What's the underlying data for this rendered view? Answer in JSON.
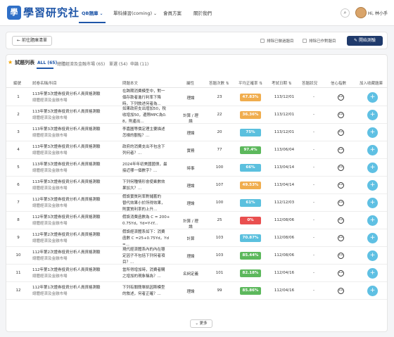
{
  "header": {
    "logo_text": "學",
    "brand": "學習研究社",
    "nav": [
      "QB題庫",
      "單科練習(coming)",
      "會員方案",
      "關於我們"
    ],
    "user": "Hi, 林小手"
  },
  "toolbar": {
    "back_label": "前往題庫清單",
    "exclude_done": "排除已做過題目",
    "exclude_marked": "排除已作對題目",
    "start_label": "開始測驗"
  },
  "list": {
    "title": "試題列表",
    "tabs": [
      "ALL (65)",
      "總體經濟及金融市場 (65)",
      "單選 (54)",
      "申論 (11)"
    ],
    "columns": [
      "編號",
      "試卷名稱/科目",
      "問題本文",
      "屬性",
      "答題次數",
      "平均正確率",
      "考試日期",
      "答題狀況",
      "信心指數",
      "加入收藏題庫"
    ],
    "more_label": "更多"
  },
  "colors": {
    "green": "#5cb85c",
    "teal": "#5bc0de",
    "orange": "#f0ad4e",
    "red": "#e94f4f"
  },
  "rows": [
    {
      "idx": "1",
      "exam": "113年第3次證券投資分析人員資格測驗",
      "subject": "總體經濟及金融市場",
      "q1": "在跨期消費模型中，對一",
      "q2": "個存款者進行利率下降",
      "q3": "時，下列敘述何者為...",
      "attr": "理論",
      "count": "23",
      "pct": "47.83%",
      "pct_color": "orange",
      "date": "113/12/01",
      "status": "-"
    },
    {
      "idx": "2",
      "exam": "113年第3次證券投資分析人員資格測驗",
      "subject": "總體經濟及金融市場",
      "q1": "如果政府支出增加50，稅",
      "q2": "收增加50，邊際MPC為0.",
      "q3": "8，則產出...",
      "attr": "計算 / 理論",
      "count": "22",
      "pct": "36.36%",
      "pct_color": "orange",
      "date": "113/12/01",
      "status": "-"
    },
    {
      "idx": "3",
      "exam": "113年第3次證券投資分析人員資格測驗",
      "subject": "總體經濟及金融市場",
      "q1": "李嘉圖等價定理主要描述",
      "q2": "怎樣的觀點？...",
      "q3": "",
      "attr": "理論",
      "count": "20",
      "pct": "75%",
      "pct_color": "teal",
      "date": "113/12/01",
      "status": "-"
    },
    {
      "idx": "4",
      "exam": "113年第3次證券投資分析人員資格測驗",
      "subject": "總體經濟及金融市場",
      "q1": "政府的消費支出不包含下",
      "q2": "列何者？...",
      "q3": "",
      "attr": "實務",
      "count": "77",
      "pct": "97.4%",
      "pct_color": "green",
      "date": "113/06/04",
      "status": "-"
    },
    {
      "idx": "5",
      "exam": "113年第3次證券投資分析人員資格測驗",
      "subject": "總體經濟及金融市場",
      "q1": "2024年年初美國國債，最",
      "q2": "接近哪一個數字？...",
      "q3": "",
      "attr": "時事",
      "count": "100",
      "pct": "66%",
      "pct_color": "teal",
      "date": "113/04/14",
      "status": "-"
    },
    {
      "idx": "6",
      "exam": "113年第3次證券投資分析人員資格測驗",
      "subject": "總體經濟及金融市場",
      "q1": "下列何種情形會使乘數效",
      "q2": "果加大？...",
      "q3": "",
      "attr": "理論",
      "count": "107",
      "pct": "49.53%",
      "pct_color": "orange",
      "date": "113/04/14",
      "status": "-"
    },
    {
      "idx": "7",
      "exam": "112年第3次證券投資分析人員資格測驗",
      "subject": "總體經濟及金融市場",
      "q1": "假設實質利率對儲蓄的",
      "q2": "替代效果小於所得效果，",
      "q3": "則實質利率的上升...",
      "attr": "理論",
      "count": "100",
      "pct": "61%",
      "pct_color": "teal",
      "date": "112/12/03",
      "status": "-"
    },
    {
      "idx": "8",
      "exam": "112年第3次證券投資分析人員資格測驗",
      "subject": "總體經濟及金融市場",
      "q1": "假設消費函數為 C = 200+",
      "q2": "0.75Yd，Yd=Y-tY...",
      "q3": "",
      "attr": "計算 / 理論",
      "count": "25",
      "pct": "0%",
      "pct_color": "red",
      "date": "112/08/06",
      "status": "-"
    },
    {
      "idx": "9",
      "exam": "112年第2次證券投資分析人員資格測驗",
      "subject": "總體經濟及金融市場",
      "q1": "假設經濟體系如下：消費",
      "q2": "函數 C =25+0.75Yd，Yd",
      "q3": "=...",
      "attr": "計算",
      "count": "103",
      "pct": "70.87%",
      "pct_color": "teal",
      "date": "112/08/06",
      "status": "-"
    },
    {
      "idx": "10",
      "exam": "112年第2次證券投資分析人員資格測驗",
      "subject": "總體經濟及金融市場",
      "q1": "現代經濟體系內的內在穩",
      "q2": "定因子不包括下列何者項",
      "q3": "目？...",
      "attr": "理論",
      "count": "103",
      "pct": "85.44%",
      "pct_color": "green",
      "date": "112/08/06",
      "status": "-"
    },
    {
      "idx": "11",
      "exam": "112年第1次證券投資分析人員資格測驗",
      "subject": "總體經濟及金融市場",
      "q1": "當所得增加時，消費者購",
      "q2": "之增加的現象稱為？...",
      "q3": "",
      "attr": "名詞定義",
      "count": "101",
      "pct": "82.18%",
      "pct_color": "green",
      "date": "112/04/16",
      "status": "-"
    },
    {
      "idx": "12",
      "exam": "112年第1次證券投資分析人員資格測驗",
      "subject": "總體經濟及金融市場",
      "q1": "下列有關簡單凱因斯模型",
      "q2": "的敘述，何者正確？...",
      "q3": "",
      "attr": "理論",
      "count": "99",
      "pct": "85.86%",
      "pct_color": "green",
      "date": "112/04/16",
      "status": "-"
    }
  ]
}
